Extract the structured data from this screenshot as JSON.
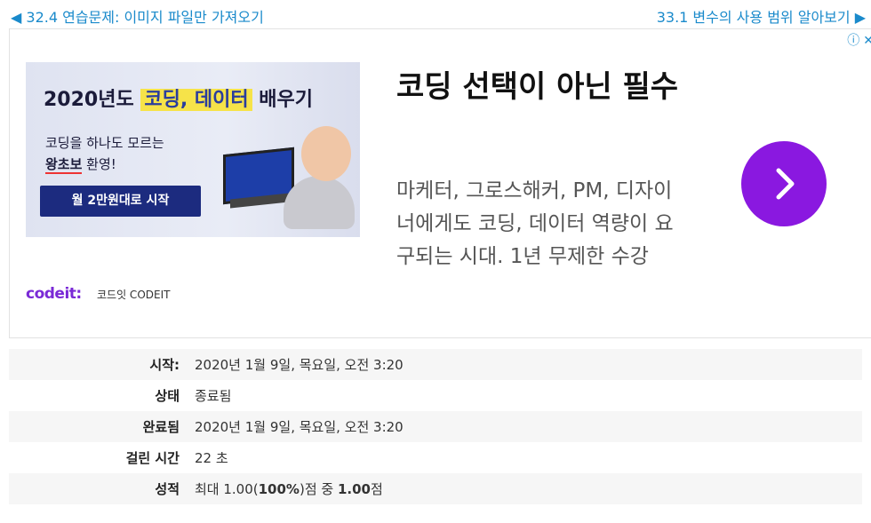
{
  "nav": {
    "prev": "◀ 32.4 연습문제: 이미지 파일만 가져오기",
    "next": "33.1 변수의 사용 범위 알아보기 ▶"
  },
  "ad": {
    "choices_icon": "ⓘ",
    "close_icon": "✕",
    "banner": {
      "headline_pre": "2020년도 ",
      "headline_highlight": "코딩, 데이터",
      "headline_post": " 배우기",
      "sub_line1": "코딩을 하나도 모르는",
      "sub_line2_bold": "왕초보",
      "sub_line2_rest": " 환영!",
      "cta": "월 2만원대로 시작"
    },
    "brand_logo": "codeit:",
    "brand_name": "코드잇 CODEIT",
    "title": "코딩 선택이 아닌 필수",
    "body": "마케터, 그로스해커, PM, 디자이너에게도 코딩, 데이터 역량이 요구되는 시대. 1년 무제한 수강",
    "accent_color": "#8a18e0"
  },
  "summary": {
    "rows": [
      {
        "label": "시작:",
        "value": "2020년 1월 9일, 목요일, 오전 3:20"
      },
      {
        "label": "상태",
        "value": "종료됨"
      },
      {
        "label": "완료됨",
        "value": "2020년 1월 9일, 목요일, 오전 3:20"
      },
      {
        "label": "걸린 시간",
        "value": "22 초"
      }
    ],
    "grade_label": "성적",
    "grade_pre": "최대 1.00(",
    "grade_pct": "100%",
    "grade_mid": ")점 중 ",
    "grade_score": "1.00",
    "grade_post": "점"
  }
}
